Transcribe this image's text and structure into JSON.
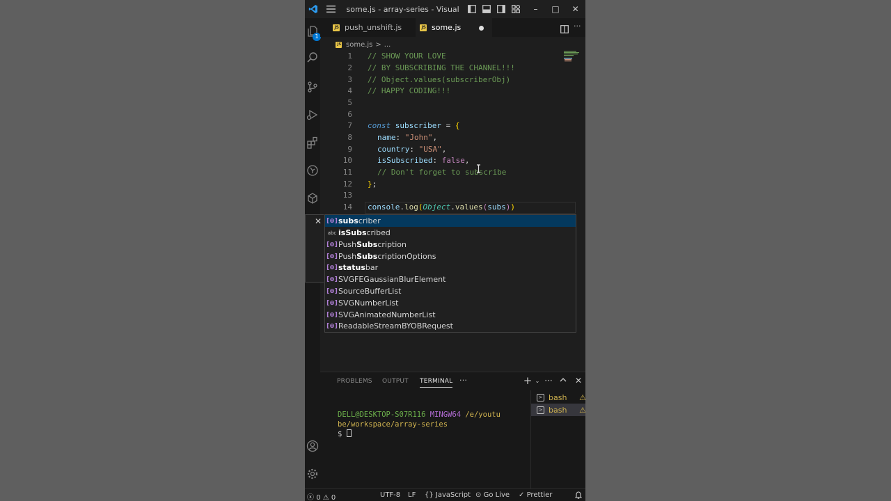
{
  "window": {
    "title": "some.js - array-series - Visual Stu...",
    "minimize": "–",
    "maximize": "□",
    "close": "✕"
  },
  "activity": {
    "source_control_badge": "1"
  },
  "tabs": [
    {
      "label": "push_unshift.js",
      "icon": "js-file-icon"
    },
    {
      "label": "some.js",
      "icon": "js-file-icon",
      "modified": true
    }
  ],
  "breadcrumb": {
    "file": "some.js",
    "sep": ">",
    "rest": "..."
  },
  "editor": {
    "line_numbers": [
      "1",
      "2",
      "3",
      "4",
      "5",
      "6",
      "7",
      "8",
      "9",
      "10",
      "11",
      "12",
      "13",
      "14"
    ],
    "lines": {
      "l1": "// SHOW YOUR LOVE",
      "l2": "// BY SUBSCRIBING THE CHANNEL!!!",
      "l3": "// Object.values(subscriberObj)",
      "l4": "// HAPPY CODING!!!",
      "l7": {
        "kw": "const",
        "name": " subscriber",
        "eq": " = ",
        "brace": "{"
      },
      "l8": {
        "key": "name",
        "colon": ": ",
        "val": "\"John\"",
        "comma": ","
      },
      "l9": {
        "key": "country",
        "colon": ": ",
        "val": "\"USA\"",
        "comma": ","
      },
      "l10": {
        "key": "isSubscribed",
        "colon": ": ",
        "val": "false",
        "comma": ","
      },
      "l11": "// Don't forget to subscribe",
      "l12": {
        "brace": "}",
        "semi": ";"
      },
      "l14": {
        "obj": "console",
        "dot": ".",
        "fn": "log",
        "p1": "(",
        "cls": "Object",
        "dot2": ".",
        "fn2": "values",
        "p2": "(",
        "arg": "subs",
        "p3": ")",
        "p4": ")"
      }
    }
  },
  "suggestions": [
    {
      "match": "subs",
      "rest": "criber",
      "pre": "",
      "kind": "variable"
    },
    {
      "match": "isSubs",
      "rest": "cribed",
      "pre": "",
      "kind": "text"
    },
    {
      "pre": "Push",
      "match": "Subs",
      "rest": "cription",
      "kind": "variable"
    },
    {
      "pre": "Push",
      "match": "Subs",
      "rest": "criptionOptions",
      "kind": "variable"
    },
    {
      "pre": "",
      "match": "status",
      "rest": "bar",
      "kind": "variable"
    },
    {
      "pre": "",
      "match": "SVGFEGaussianBlurElement",
      "rest": "",
      "kind": "variable"
    },
    {
      "pre": "",
      "match": "SourceBufferList",
      "rest": "",
      "kind": "variable"
    },
    {
      "pre": "",
      "match": "SVGNumberList",
      "rest": "",
      "kind": "variable"
    },
    {
      "pre": "",
      "match": "SVGAnimatedNumberList",
      "rest": "",
      "kind": "variable"
    },
    {
      "pre": "",
      "match": "ReadableStreamBYOBRequest",
      "rest": "",
      "kind": "variable"
    }
  ],
  "suggest_icons": {
    "variable": "[⊚]",
    "text": "abc"
  },
  "panel": {
    "tabs": [
      "PROBLEMS",
      "OUTPUT",
      "TERMINAL"
    ],
    "more": "···",
    "terminal": {
      "user": "DELL@DESKTOP-S07R116",
      "system": " MINGW64",
      "path1": " /e/youtu",
      "path2": "be/workspace/array-series",
      "prompt": "$ "
    },
    "terminals": [
      {
        "label": "bash"
      },
      {
        "label": "bash",
        "selected": true
      }
    ]
  },
  "status": {
    "errors": "0",
    "warnings": "0",
    "encoding": "UTF-8",
    "eol": "LF",
    "language": "JavaScript",
    "golive": "Go Live",
    "prettier": "Prettier"
  },
  "colors": {
    "editor_bg": "#1e1e1e",
    "keyword": "#569cd6",
    "string": "#ce9178",
    "comment": "#6a9955",
    "selection": "#04395e"
  }
}
